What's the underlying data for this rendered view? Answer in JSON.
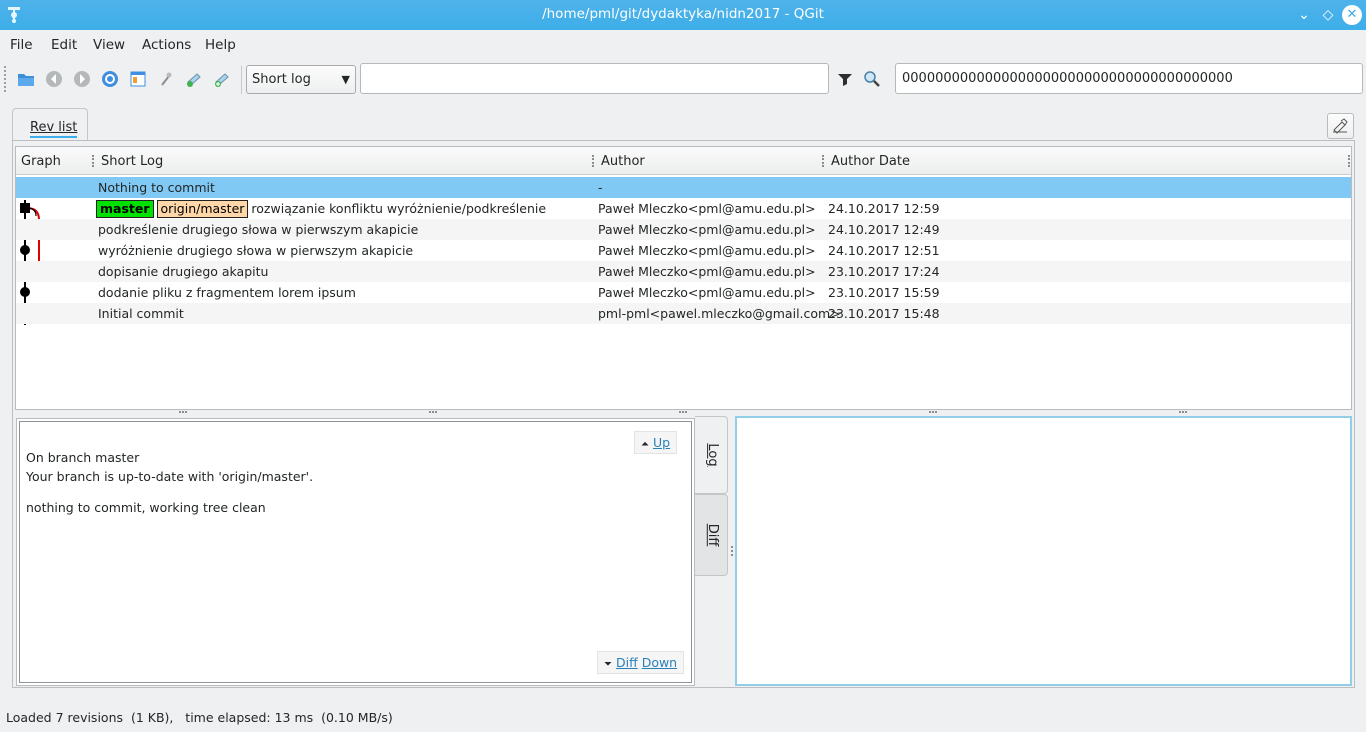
{
  "window": {
    "title": "/home/pml/git/dydaktyka/nidn2017 - QGit",
    "minimize": "⌄",
    "maximize": "◇",
    "close": "✕"
  },
  "menu": [
    "File",
    "Edit",
    "View",
    "Actions",
    "Help"
  ],
  "toolbar": {
    "icons": [
      "open-folder-icon",
      "back-icon",
      "forward-icon",
      "refresh-icon",
      "file-view-icon",
      "tools-icon",
      "commit-icon",
      "patch-icon"
    ],
    "log_mode": "Short log",
    "filter_value": "",
    "filter_icon": "filter-icon",
    "search_icon": "search-icon",
    "sha_value": "0000000000000000000000000000000000000000"
  },
  "tabs": {
    "revlist": "Rev list"
  },
  "table": {
    "headers": {
      "graph": "Graph",
      "short_log": "Short Log",
      "author": "Author",
      "author_date": "Author Date"
    },
    "rows": [
      {
        "short_log": "Nothing to commit",
        "author": "-",
        "date": "",
        "tags": []
      },
      {
        "short_log": "rozwiązanie konfliktu wyróżnienie/podkreślenie",
        "author": "Paweł Mleczko<pml@amu.edu.pl>",
        "date": "24.10.2017 12:59",
        "tags": [
          "master",
          "origin/master"
        ]
      },
      {
        "short_log": "podkreślenie drugiego słowa w pierwszym akapicie",
        "author": "Paweł Mleczko<pml@amu.edu.pl>",
        "date": "24.10.2017 12:49",
        "tags": []
      },
      {
        "short_log": "wyróżnienie drugiego słowa w pierwszym akapicie",
        "author": "Paweł Mleczko<pml@amu.edu.pl>",
        "date": "24.10.2017 12:51",
        "tags": []
      },
      {
        "short_log": "dopisanie drugiego akapitu",
        "author": "Paweł Mleczko<pml@amu.edu.pl>",
        "date": "23.10.2017 17:24",
        "tags": []
      },
      {
        "short_log": "dodanie pliku z fragmentem lorem ipsum",
        "author": "Paweł Mleczko<pml@amu.edu.pl>",
        "date": "23.10.2017 15:59",
        "tags": []
      },
      {
        "short_log": "Initial commit",
        "author": "pml-pml<pawel.mleczko@gmail.com>",
        "date": "23.10.2017 15:48",
        "tags": []
      }
    ]
  },
  "log": {
    "lines": [
      "On branch master",
      "Your branch is up-to-date with 'origin/master'.",
      "nothing to commit, working tree clean"
    ],
    "up": "Up",
    "diff": "Diff",
    "down": "Down"
  },
  "side_tabs": {
    "log": "Log",
    "diff": "Diff"
  },
  "status": "Loaded 7 revisions  (1 KB),   time elapsed: 13 ms  (0.10 MB/s)",
  "colors": {
    "selection": "#80c9f4",
    "title_bar": "#3daee9",
    "master_tag": "#00e100",
    "origin_tag": "#ffd7a8",
    "merge_line": "#e00000"
  }
}
